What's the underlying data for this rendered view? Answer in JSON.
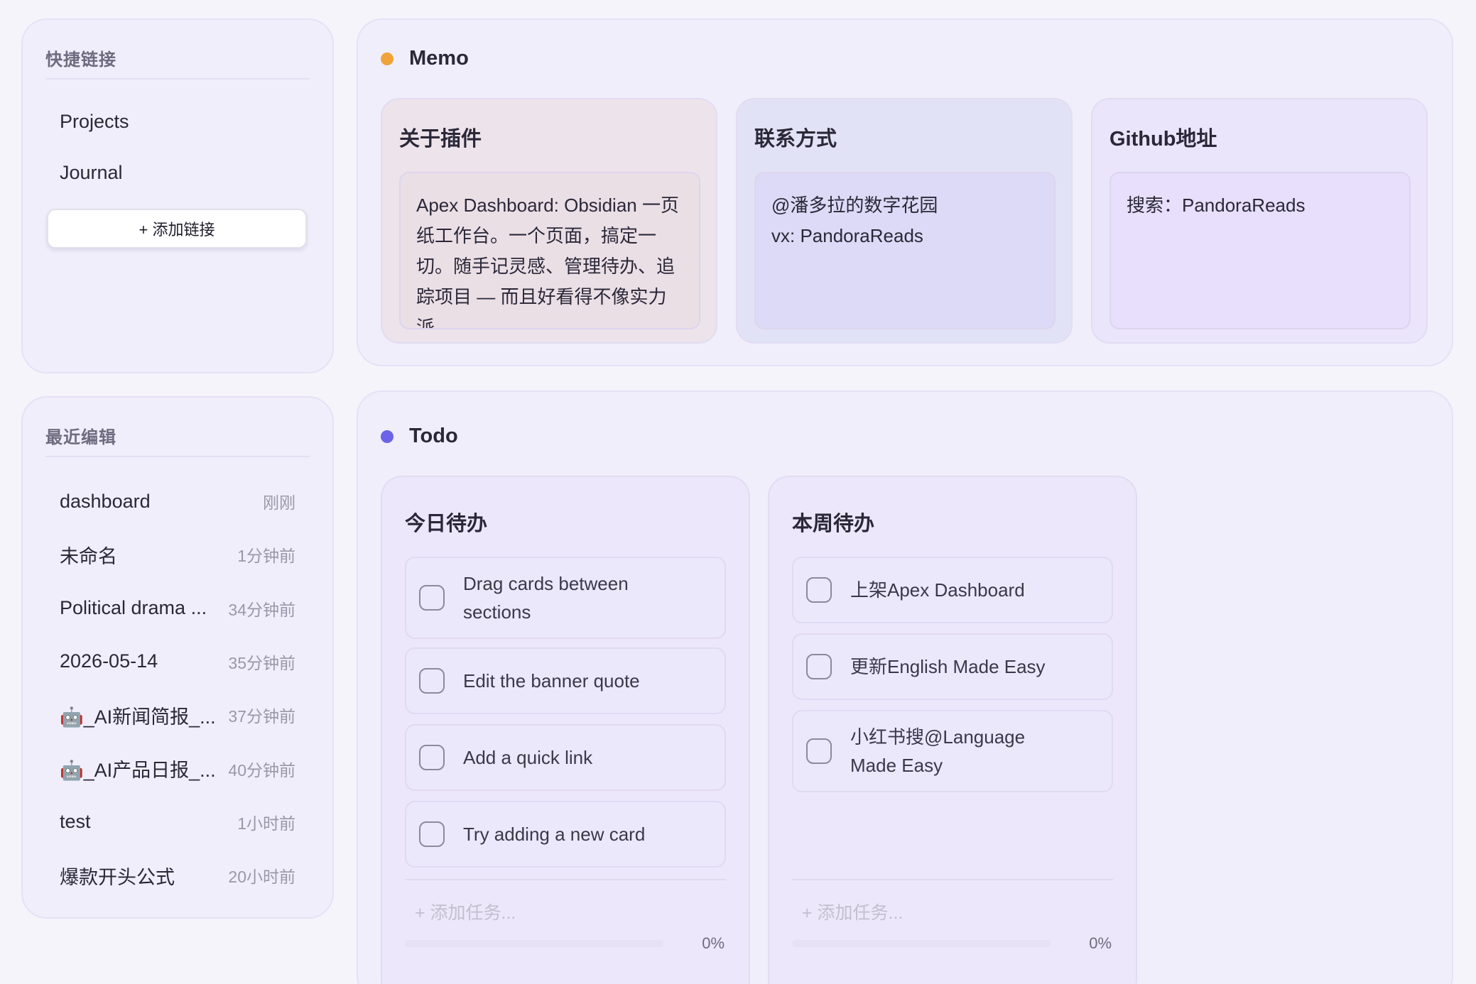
{
  "quick_links": {
    "title": "快捷链接",
    "items": [
      {
        "label": "Projects"
      },
      {
        "label": "Journal"
      }
    ],
    "add_button": "+ 添加链接"
  },
  "recent": {
    "title": "最近编辑",
    "items": [
      {
        "name": "dashboard",
        "time": "刚刚"
      },
      {
        "name": "未命名",
        "time": "1分钟前"
      },
      {
        "name": "Political drama ...",
        "time": "34分钟前"
      },
      {
        "name": "2026-05-14",
        "time": "35分钟前"
      },
      {
        "name": "🤖_AI新闻简报_...",
        "time": "37分钟前"
      },
      {
        "name": "🤖_AI产品日报_...",
        "time": "40分钟前"
      },
      {
        "name": "test",
        "time": "1小时前"
      },
      {
        "name": "爆款开头公式",
        "time": "20小时前"
      }
    ]
  },
  "memo": {
    "title": "Memo",
    "dot_color": "#f0a33a",
    "cards": [
      {
        "title": "关于插件",
        "body": "Apex Dashboard: Obsidian 一页纸工作台。一个页面，搞定一切。随手记灵感、管理待办、追踪项目 — 而且好看得不像实力派",
        "bg": "#ede3ea",
        "body_bg": "#ebdfe6"
      },
      {
        "title": "联系方式",
        "body": "@潘多拉的数字花园\nvx: PandoraReads",
        "bg": "#e2e2f7",
        "body_bg": "#dcdaf6"
      },
      {
        "title": "Github地址",
        "body": "搜索：PandoraReads",
        "bg": "#ebe5fb",
        "body_bg": "#e7dffb"
      }
    ]
  },
  "todo": {
    "title": "Todo",
    "dot_color": "#6b63e8",
    "lists": [
      {
        "title": "今日待办",
        "items": [
          {
            "text": "Drag cards between sections",
            "done": false
          },
          {
            "text": "Edit the banner quote",
            "done": false
          },
          {
            "text": "Add a quick link",
            "done": false
          },
          {
            "text": "Try adding a new card",
            "done": false
          }
        ],
        "add_placeholder": "+ 添加任务...",
        "progress": 0,
        "progress_label": "0%"
      },
      {
        "title": "本周待办",
        "items": [
          {
            "text": "上架Apex Dashboard",
            "done": false
          },
          {
            "text": "更新English Made Easy",
            "done": false
          },
          {
            "text": "小红书搜@Language Made Easy",
            "done": false
          }
        ],
        "add_placeholder": "+ 添加任务...",
        "progress": 0,
        "progress_label": "0%"
      }
    ]
  }
}
